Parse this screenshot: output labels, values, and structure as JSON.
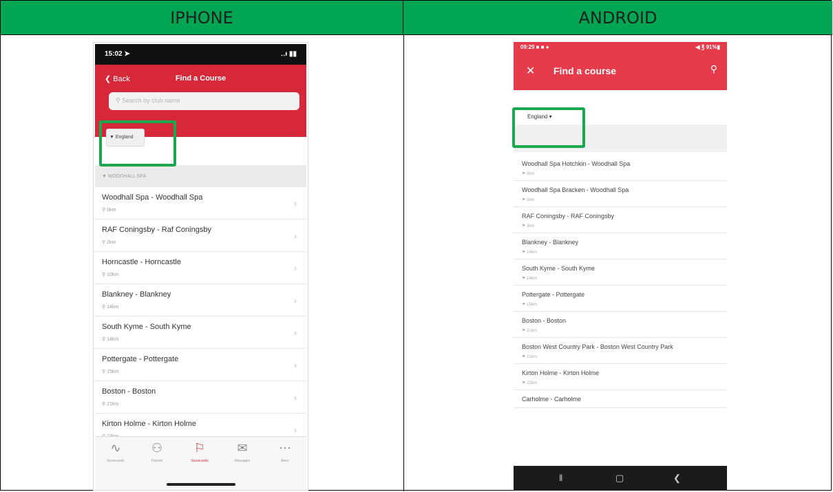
{
  "headers": {
    "iphone": "IPHONE",
    "android": "ANDROID"
  },
  "iphone": {
    "status_time": "15:02 ➤",
    "status_icons": "‥ᵼ ▮▮",
    "back_label": "Back",
    "title": "Find a Course",
    "search_placeholder": "Search by club name",
    "dropdown_label": "England",
    "section_label": "WOODHALL SPA",
    "items": [
      {
        "name": "Woodhall Spa - Woodhall Spa",
        "dist": "0km"
      },
      {
        "name": "RAF Coningsby - Raf Coningsby",
        "dist": "2km"
      },
      {
        "name": "Horncastle - Horncastle",
        "dist": "10km"
      },
      {
        "name": "Blankney - Blankney",
        "dist": "14km"
      },
      {
        "name": "South Kyme - South Kyme",
        "dist": "14km"
      },
      {
        "name": "Pottergate - Pottergate",
        "dist": "15km"
      },
      {
        "name": "Boston - Boston",
        "dist": "21km"
      },
      {
        "name": "Kirton Holme - Kirton Holme",
        "dist": "23km"
      }
    ],
    "tabs": [
      {
        "icon": "∿",
        "label": "Scorecards"
      },
      {
        "icon": "⚇",
        "label": "Friends"
      },
      {
        "icon": "⚐",
        "label": "Scorecards"
      },
      {
        "icon": "✉",
        "label": "Messages"
      },
      {
        "icon": "⋯",
        "label": "More"
      }
    ]
  },
  "android": {
    "status_time": "09:29 ■ ■ ●",
    "status_icons": "◀ ℥ 91%▮",
    "title": "Find a course",
    "dropdown_label": "England",
    "items": [
      {
        "name": "Woodhall Spa Hotchkin - Woodhall Spa",
        "dist": "0km"
      },
      {
        "name": "Woodhall Spa Bracken - Woodhall Spa",
        "dist": "0km"
      },
      {
        "name": "RAF Coningsby - RAF Coningsby",
        "dist": "3km"
      },
      {
        "name": "Blankney - Blankney",
        "dist": "14km"
      },
      {
        "name": "South Kyme - South Kyme",
        "dist": "14km"
      },
      {
        "name": "Pottergate - Pottergate",
        "dist": "15km"
      },
      {
        "name": "Boston - Boston",
        "dist": "21km"
      },
      {
        "name": "Boston West Country Park - Boston West Country Park",
        "dist": "21km"
      },
      {
        "name": "Kirton Holme - Kirton Holme",
        "dist": "22km"
      },
      {
        "name": "Carholme - Carholme",
        "dist": ""
      }
    ]
  },
  "colors": {
    "header_green": "#00a651",
    "ios_red": "#d7283a",
    "android_red": "#e63b4a",
    "highlight": "#1aa84f"
  }
}
